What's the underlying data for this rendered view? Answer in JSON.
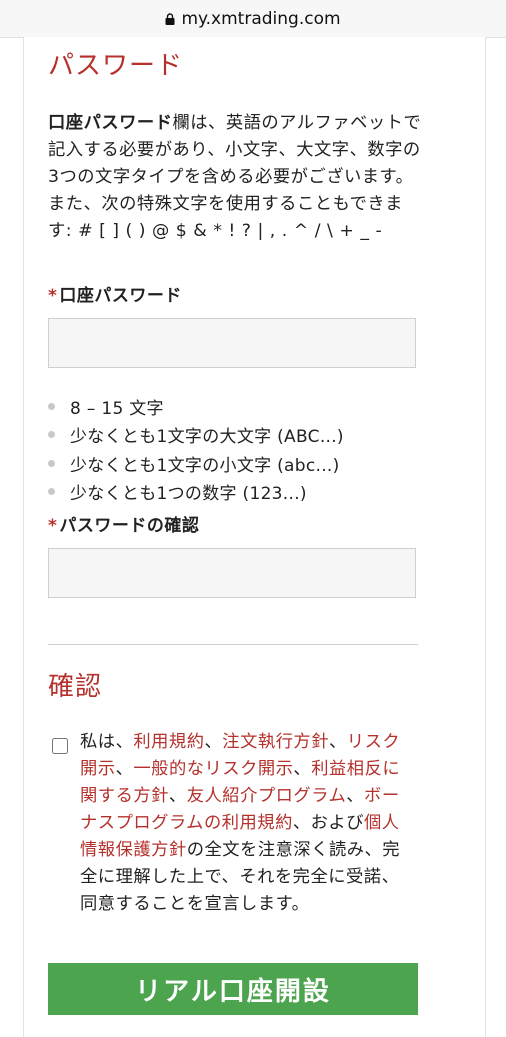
{
  "browser": {
    "url": "my.xmtrading.com"
  },
  "password_section": {
    "heading": "パスワード",
    "intro_bold": "口座パスワード",
    "intro_rest": "欄は、英語のアルファベットで記入する必要があり、小文字、大文字、数字の3つの文字タイプを含める必要がございます。また、次の特殊文字を使用することもできます: # [ ] ( ) @ $ & * ! ? | , . ^ / \\ + _ -",
    "password_field": {
      "required_mark": "*",
      "label": "口座パスワード",
      "value": ""
    },
    "rules": [
      "8 – 15 文字",
      "少なくとも1文字の大文字 (ABC...)",
      "少なくとも1文字の小文字 (abc...)",
      "少なくとも1つの数字 (123...)"
    ],
    "confirm_field": {
      "required_mark": "*",
      "label": "パスワードの確認",
      "value": ""
    }
  },
  "confirm_section": {
    "heading": "確認",
    "checked": false,
    "agreement": {
      "t0": "私は、",
      "link_terms": "利用規約",
      "sep1": "、",
      "link_execution": "注文執行方針",
      "sep2": "、",
      "link_risk": "リスク開示",
      "sep3": "、",
      "link_general_risk": "一般的なリスク開示",
      "sep4": "、",
      "link_conflict": "利益相反に関する方針",
      "sep5": "、",
      "link_referral": "友人紹介プログラム",
      "sep6": "、",
      "link_bonus": "ボーナスプログラムの利用規約",
      "t1": "、および",
      "link_privacy": "個人情報保護方針",
      "t2": "の全文を注意深く読み、完全に理解した上で、それを完全に受諾、同意することを宣言します。"
    }
  },
  "submit_label": "リアル口座開設",
  "colors": {
    "accent_red": "#b5312d",
    "button_green": "#4da44e"
  }
}
